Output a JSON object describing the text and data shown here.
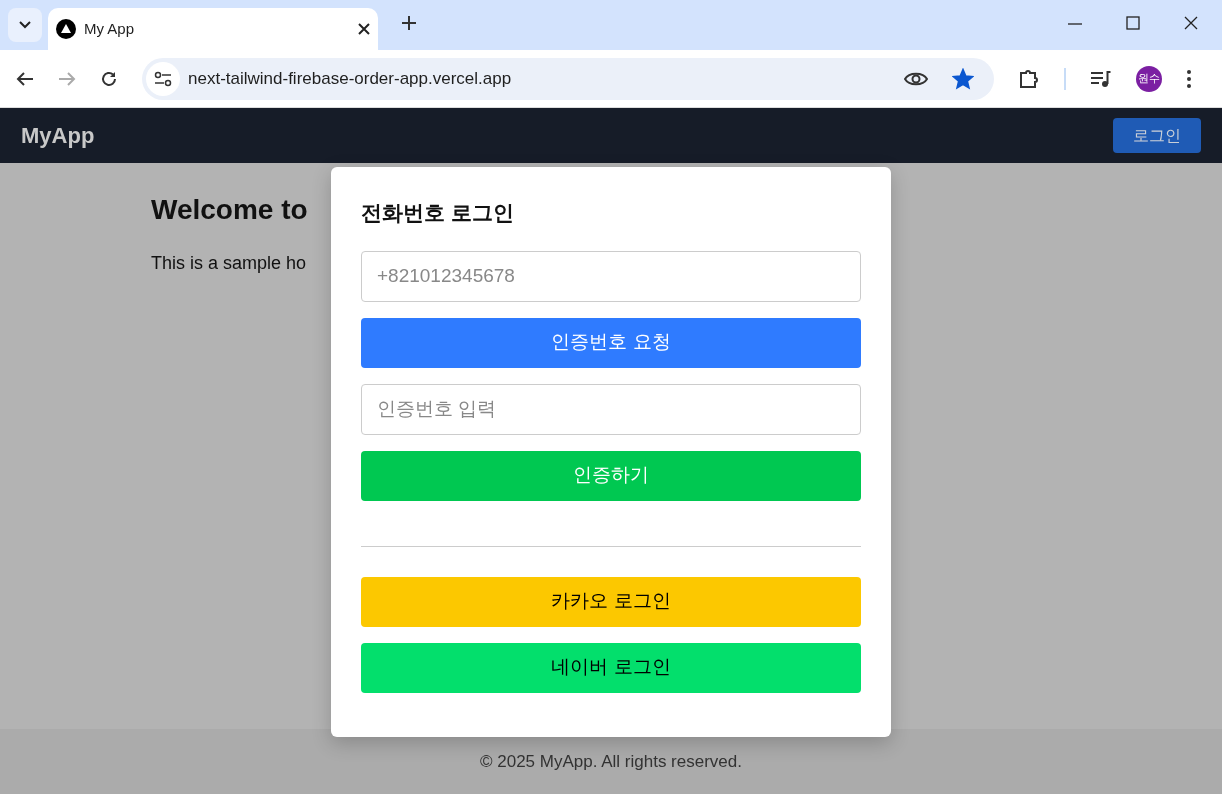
{
  "browser": {
    "tab": {
      "title": "My App"
    },
    "address": "next-tailwind-firebase-order-app.vercel.app",
    "bookmarked": true,
    "profile": "원수"
  },
  "navbar": {
    "brand": "MyApp",
    "login_button": "로그인"
  },
  "page": {
    "heading": "Welcome to",
    "text": "This is a sample ho"
  },
  "modal": {
    "title": "전화번호 로그인",
    "phone_field": {
      "placeholder": "+821012345678"
    },
    "request_button": "인증번호 요청",
    "code_field": {
      "placeholder": "인증번호 입력"
    },
    "verify_button": "인증하기",
    "social_buttons": [
      {
        "label": "카카오 로그인",
        "color": "#fcc800"
      },
      {
        "label": "네이버 로그인",
        "color": "#03df6c"
      }
    ]
  },
  "footer": "© 2025 MyApp. All rights reserved."
}
